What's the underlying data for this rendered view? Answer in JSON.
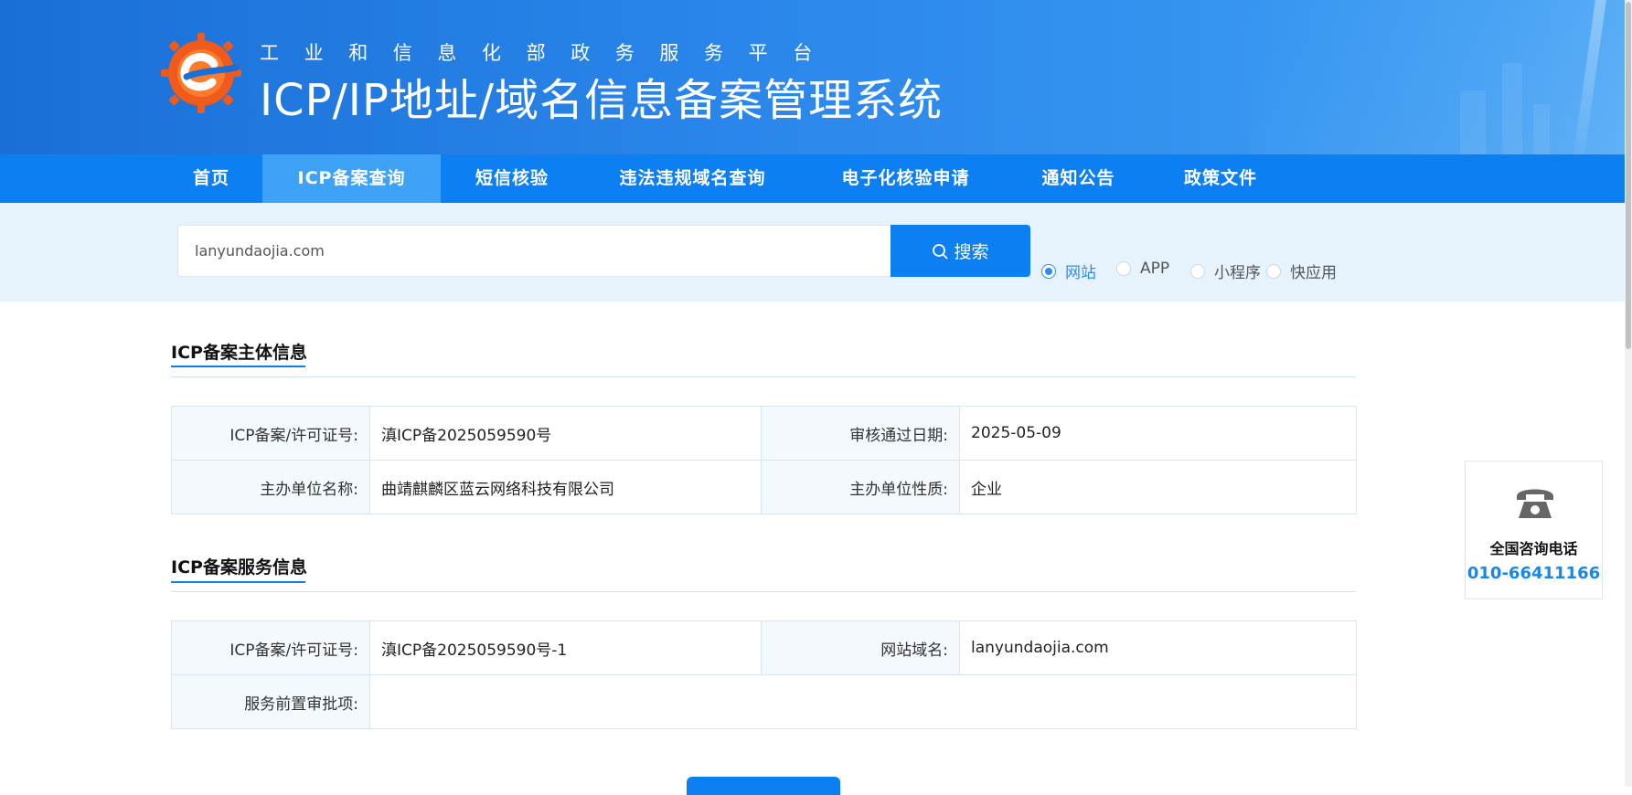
{
  "header": {
    "subtitle": "工业和信息化部政务服务平台",
    "title": "ICP/IP地址/域名信息备案管理系统"
  },
  "nav": {
    "items": [
      "首页",
      "ICP备案查询",
      "短信核验",
      "违法违规域名查询",
      "电子化核验申请",
      "通知公告",
      "政策文件"
    ],
    "active_index": 1
  },
  "search": {
    "value": "lanyundaojia.com",
    "button_label": "搜索",
    "types": [
      "网站",
      "APP",
      "小程序",
      "快应用"
    ],
    "selected_type": "网站"
  },
  "subject_section": {
    "title": "ICP备案主体信息",
    "rows": [
      {
        "k1": "ICP备案/许可证号:",
        "v1": "滇ICP备2025059590号",
        "k2": "审核通过日期:",
        "v2": "2025-05-09"
      },
      {
        "k1": "主办单位名称:",
        "v1": "曲靖麒麟区蓝云网络科技有限公司",
        "k2": "主办单位性质:",
        "v2": "企业"
      }
    ]
  },
  "service_section": {
    "title": "ICP备案服务信息",
    "rows": [
      {
        "k1": "ICP备案/许可证号:",
        "v1": "滇ICP备2025059590号-1",
        "k2": "网站域名:",
        "v2": "lanyundaojia.com"
      }
    ],
    "approval_label": "服务前置审批项:",
    "approval_value": ""
  },
  "side_widget": {
    "label": "全国咨询电话",
    "phone": "010-66411166"
  },
  "colors": {
    "primary": "#0c7ff2",
    "nav_active": "#3ea3f6",
    "search_band": "#e6f3fd",
    "phone_text": "#1a86e8"
  }
}
